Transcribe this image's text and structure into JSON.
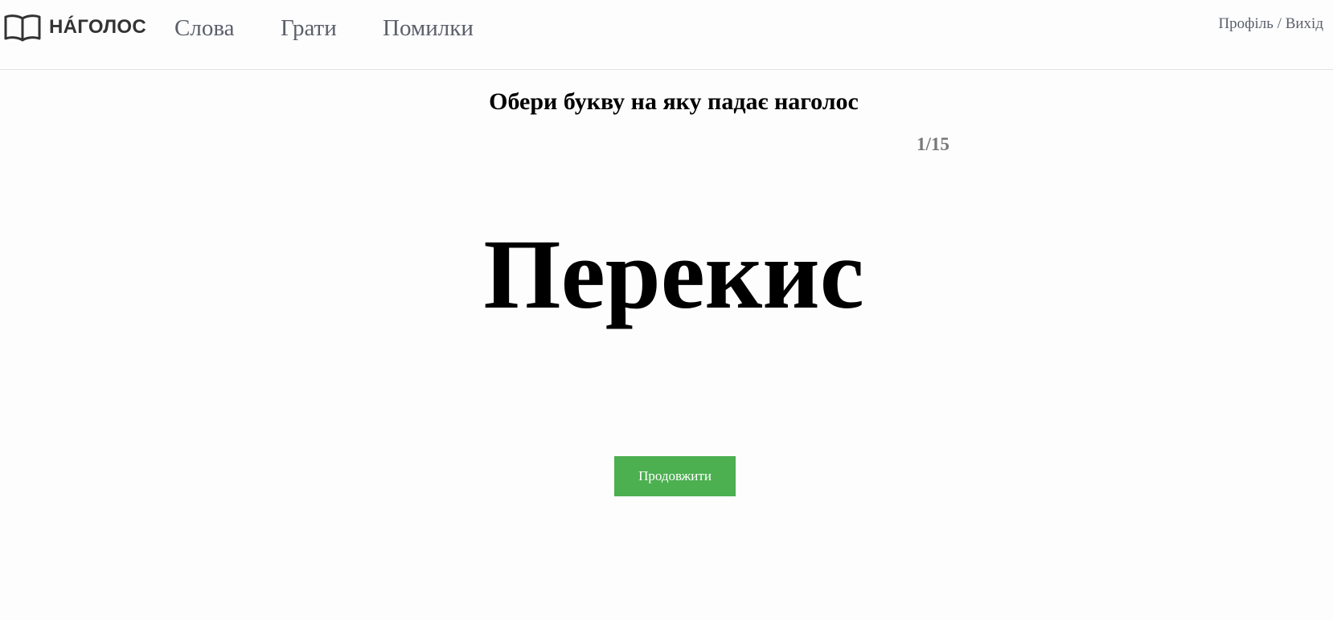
{
  "header": {
    "logo_text": "НÁГОЛОС",
    "nav": [
      {
        "label": "Слова"
      },
      {
        "label": "Грати"
      },
      {
        "label": "Помилки"
      }
    ],
    "user_links": {
      "profile": "Профіль",
      "separator": " / ",
      "logout": "Вихід"
    }
  },
  "quiz": {
    "instruction": "Обери букву на яку падає наголос",
    "counter": "1/15",
    "word_letters": [
      "П",
      "е",
      "р",
      "е",
      "к",
      "и",
      "с"
    ],
    "continue_label": "Продовжити"
  },
  "colors": {
    "accent": "#4caf50",
    "nav_text": "#5c5f6b",
    "counter_text": "#777777"
  },
  "icons": {
    "logo": "open-book-icon"
  }
}
